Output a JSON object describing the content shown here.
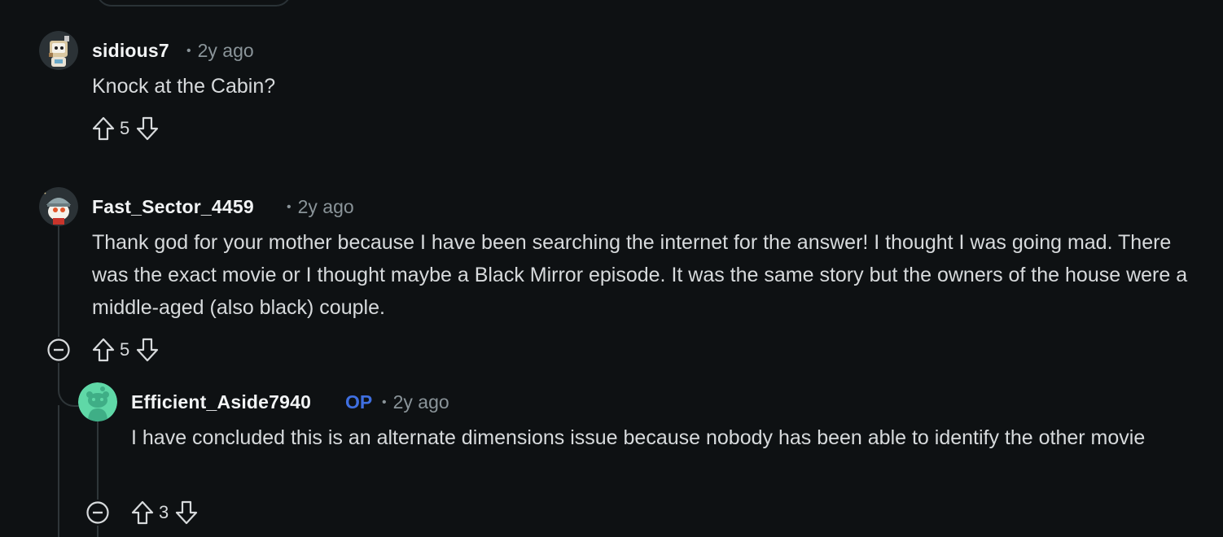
{
  "comments": [
    {
      "username": "sidious7",
      "time": "2y ago",
      "body": "Knock at the Cabin?",
      "score": "5",
      "avatar_icon": "snoo-avatar-robot-icon"
    },
    {
      "username": "Fast_Sector_4459",
      "time": "2y ago",
      "body": "Thank god for your mother because I have been searching the internet for the answer! I thought I was going mad. There was the exact movie or I thought maybe a Black Mirror episode. It was the same story but the owners of the house were a middle-aged (also black) couple.",
      "score": "5",
      "avatar_icon": "snoo-avatar-explorer-icon"
    },
    {
      "username": "Efficient_Aside7940",
      "op_label": "OP",
      "time": "2y ago",
      "body": "I have concluded this is an alternate dimensions issue because nobody has been able to identify the other movie",
      "score": "3",
      "avatar_icon": "snoo-avatar-default-icon"
    }
  ],
  "meta_separator": "•",
  "colors": {
    "background": "#0e1113",
    "text": "#d7dadc",
    "muted": "#8a9499",
    "op_accent": "#3f6fe0",
    "thread_line": "#2f3639"
  }
}
